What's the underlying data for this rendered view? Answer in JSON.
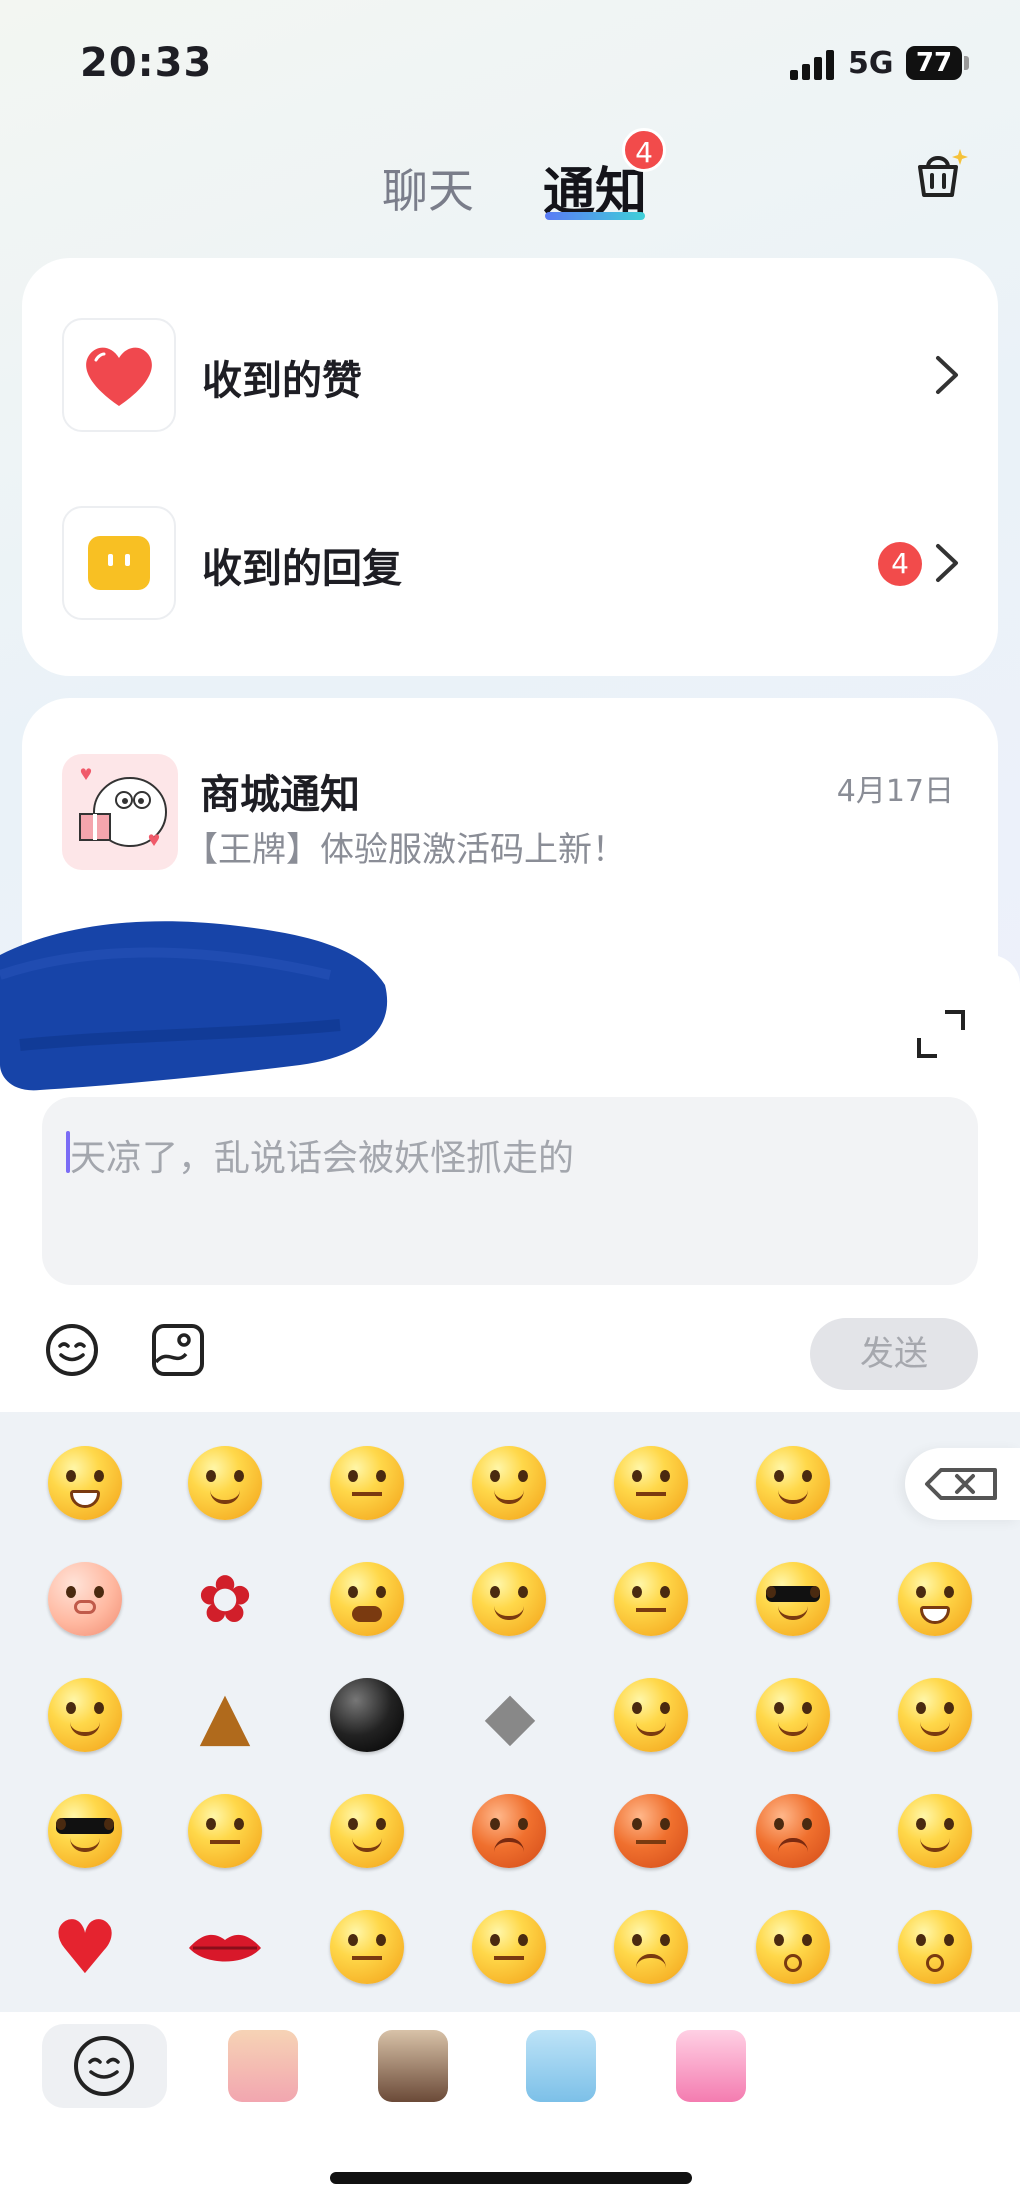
{
  "status_bar": {
    "time": "20:33",
    "network": "5G",
    "battery": "77"
  },
  "tabs": [
    {
      "label": "聊天",
      "active": false
    },
    {
      "label": "通知",
      "active": true,
      "badge": "4"
    }
  ],
  "shop": {
    "icon": "shopping-basket-icon"
  },
  "notify_list": [
    {
      "label": "收到的赞",
      "icon": "heart-icon"
    },
    {
      "label": "收到的回复",
      "icon": "reply-bubble-icon",
      "badge": "4"
    }
  ],
  "mall_notice": {
    "title": "商城通知",
    "date": "4月17日",
    "preview": "【王牌】体验服激活码上新！"
  },
  "composer": {
    "placeholder": "天凉了，乱说话会被妖怪抓走的",
    "send_label": "发送",
    "colors": {
      "caret": "#7b6cf5",
      "badge": "#f24b4b"
    }
  },
  "emoji_grid": [
    [
      "grin",
      "tongue-wink",
      "sweat-meh",
      "giggle",
      "think",
      "hammer-hit"
    ],
    [
      "pig",
      "rose",
      "crying",
      "sob",
      "shush",
      "cool-smirk",
      "laugh"
    ],
    [
      "shy",
      "poop",
      "bomb",
      "cleaver",
      "smile",
      "heart-eyes",
      "blush"
    ],
    [
      "sunglasses",
      "teary",
      "smile-plain",
      "angry",
      "sleepy-red",
      "scared-red",
      "sweat-smile"
    ],
    [
      "heart",
      "lips",
      "eye-roll",
      "skeptical",
      "sad",
      "surprised",
      "question"
    ]
  ],
  "sticker_tabs": [
    "emoji-tab",
    "sticker-pack-1",
    "sticker-pack-2",
    "sticker-pack-3",
    "sticker-pack-4"
  ]
}
